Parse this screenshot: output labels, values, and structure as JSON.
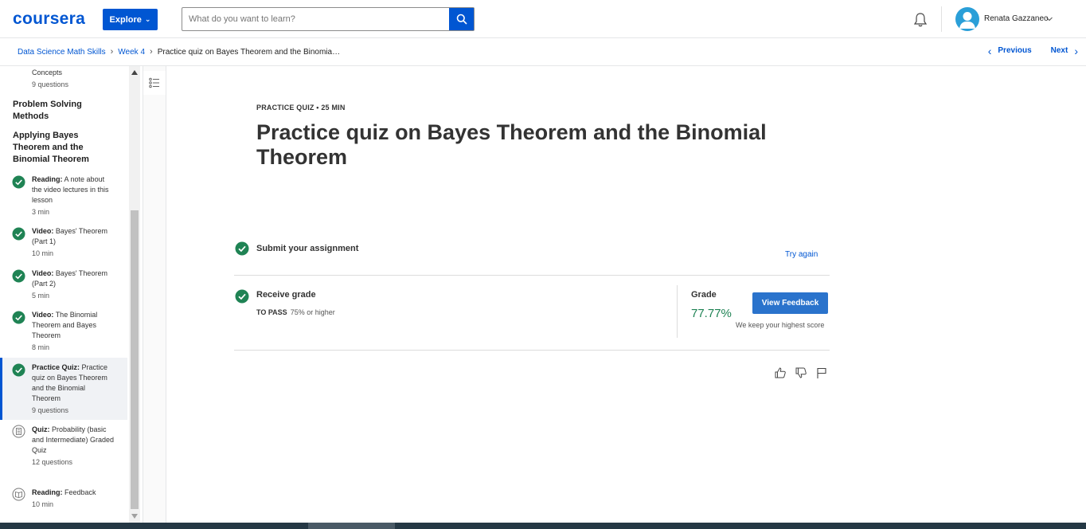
{
  "header": {
    "logo": "coursera",
    "explore_label": "Explore",
    "search_placeholder": "What do you want to learn?",
    "user_name": "Renata Gazzaneo"
  },
  "breadcrumb": {
    "items": [
      "Data Science Math Skills",
      "Week 4",
      "Practice quiz on Bayes Theorem and the Binomia…"
    ],
    "previous_label": "Previous",
    "next_label": "Next"
  },
  "sidebar": {
    "partial_label": "Concepts",
    "partial_meta": "9 questions",
    "sections": [
      "Problem Solving Methods",
      "Applying Bayes Theorem and the Binomial Theorem"
    ],
    "items": [
      {
        "type": "Reading:",
        "title": "A note about the video lectures in this lesson",
        "meta": "3 min",
        "status": "completed"
      },
      {
        "type": "Video:",
        "title": "Bayes' Theorem (Part 1)",
        "meta": "10 min",
        "status": "completed"
      },
      {
        "type": "Video:",
        "title": "Bayes' Theorem (Part 2)",
        "meta": "5 min",
        "status": "completed"
      },
      {
        "type": "Video:",
        "title": "The Binomial Theorem and Bayes Theorem",
        "meta": "8 min",
        "status": "completed"
      },
      {
        "type": "Practice Quiz:",
        "title": "Practice quiz on Bayes Theorem and the Binomial Theorem",
        "meta": "9 questions",
        "status": "completed"
      },
      {
        "type": "Quiz:",
        "title": "Probability (basic and Intermediate) Graded Quiz",
        "meta": "12 questions",
        "status": "pending"
      },
      {
        "type": "Reading:",
        "title": "Feedback",
        "meta": "10 min",
        "status": "pending"
      }
    ]
  },
  "main": {
    "kicker": "PRACTICE QUIZ • 25 MIN",
    "title": "Practice quiz on Bayes Theorem and the Binomial Theorem",
    "submit_label": "Submit your assignment",
    "try_again_label": "Try again",
    "receive_label": "Receive grade",
    "to_pass_label": "TO PASS",
    "to_pass_value": "75% or higher",
    "grade_label": "Grade",
    "grade_value": "77.77%",
    "view_feedback_label": "View Feedback",
    "keep_note": "We keep your highest score"
  },
  "colors": {
    "brand": "#0056d2",
    "success": "#1f8354",
    "button": "#2a73cc"
  }
}
